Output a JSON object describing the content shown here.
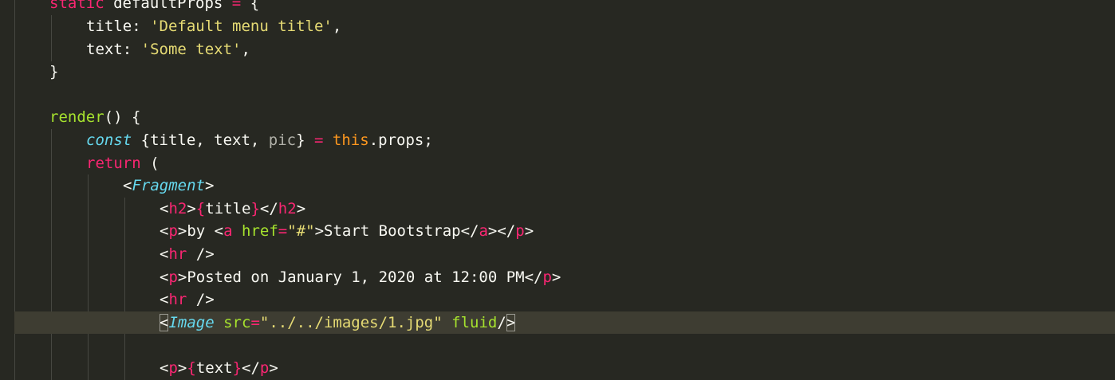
{
  "editor": {
    "theme": "monokai",
    "colors": {
      "background": "#272822",
      "active_line": "#3e3d32",
      "plain": "#f8f8f2",
      "keyword": "#f92672",
      "function": "#a6e22e",
      "string": "#e6db74",
      "storage": "#66d9ef",
      "this": "#fd971f"
    },
    "active_line_index": 14,
    "lines": [
      {
        "tokens": [
          [
            "k",
            "static"
          ],
          [
            "p",
            " defaultProps "
          ],
          [
            "k",
            "="
          ],
          [
            "p",
            " {"
          ]
        ]
      },
      {
        "tokens": [
          [
            "p",
            "title: "
          ],
          [
            "s",
            "'Default menu title'"
          ],
          [
            "p",
            ","
          ]
        ]
      },
      {
        "tokens": [
          [
            "p",
            "text: "
          ],
          [
            "s",
            "'Some text'"
          ],
          [
            "p",
            ","
          ]
        ]
      },
      {
        "tokens": [
          [
            "p",
            "}"
          ]
        ]
      },
      {
        "tokens": []
      },
      {
        "tokens": [
          [
            "f",
            "render"
          ],
          [
            "p",
            "() {"
          ]
        ]
      },
      {
        "tokens": [
          [
            "c",
            "const"
          ],
          [
            "p",
            " {title, text, "
          ],
          [
            "g",
            "pic"
          ],
          [
            "p",
            "} "
          ],
          [
            "k",
            "="
          ],
          [
            "p",
            " "
          ],
          [
            "o",
            "this"
          ],
          [
            "p",
            ".props;"
          ]
        ]
      },
      {
        "tokens": [
          [
            "k",
            "return"
          ],
          [
            "p",
            " ("
          ]
        ]
      },
      {
        "tokens": [
          [
            "p",
            "<"
          ],
          [
            "c",
            "Fragment"
          ],
          [
            "p",
            ">"
          ]
        ]
      },
      {
        "tokens": [
          [
            "p",
            "<"
          ],
          [
            "t",
            "h2"
          ],
          [
            "p",
            ">"
          ],
          [
            "k",
            "{"
          ],
          [
            "p",
            "title"
          ],
          [
            "k",
            "}"
          ],
          [
            "p",
            "</"
          ],
          [
            "t",
            "h2"
          ],
          [
            "p",
            ">"
          ]
        ]
      },
      {
        "tokens": [
          [
            "p",
            "<"
          ],
          [
            "t",
            "p"
          ],
          [
            "p",
            ">by <"
          ],
          [
            "t",
            "a"
          ],
          [
            "p",
            " "
          ],
          [
            "a",
            "href"
          ],
          [
            "k",
            "="
          ],
          [
            "s",
            "\"#\""
          ],
          [
            "p",
            ">Start Bootstrap</"
          ],
          [
            "t",
            "a"
          ],
          [
            "p",
            "></"
          ],
          [
            "t",
            "p"
          ],
          [
            "p",
            ">"
          ]
        ]
      },
      {
        "tokens": [
          [
            "p",
            "<"
          ],
          [
            "t",
            "hr"
          ],
          [
            "p",
            " />"
          ]
        ]
      },
      {
        "tokens": [
          [
            "p",
            "<"
          ],
          [
            "t",
            "p"
          ],
          [
            "p",
            ">Posted on January 1, 2020 at 12:00 PM</"
          ],
          [
            "t",
            "p"
          ],
          [
            "p",
            ">"
          ]
        ]
      },
      {
        "tokens": [
          [
            "p",
            "<"
          ],
          [
            "t",
            "hr"
          ],
          [
            "p",
            " />"
          ]
        ]
      },
      {
        "tokens": [
          [
            "pb",
            "<"
          ],
          [
            "c",
            "Image"
          ],
          [
            "p",
            " "
          ],
          [
            "a",
            "src"
          ],
          [
            "k",
            "="
          ],
          [
            "s",
            "\"../../images/1.jpg\""
          ],
          [
            "p",
            " "
          ],
          [
            "a",
            "fluid"
          ],
          [
            "p",
            "/"
          ],
          [
            "pb",
            ">"
          ]
        ]
      },
      {
        "tokens": []
      },
      {
        "tokens": [
          [
            "p",
            "<"
          ],
          [
            "t",
            "p"
          ],
          [
            "p",
            ">"
          ],
          [
            "k",
            "{"
          ],
          [
            "p",
            "text"
          ],
          [
            "k",
            "}"
          ],
          [
            "p",
            "</"
          ],
          [
            "t",
            "p"
          ],
          [
            "p",
            ">"
          ]
        ]
      }
    ]
  }
}
